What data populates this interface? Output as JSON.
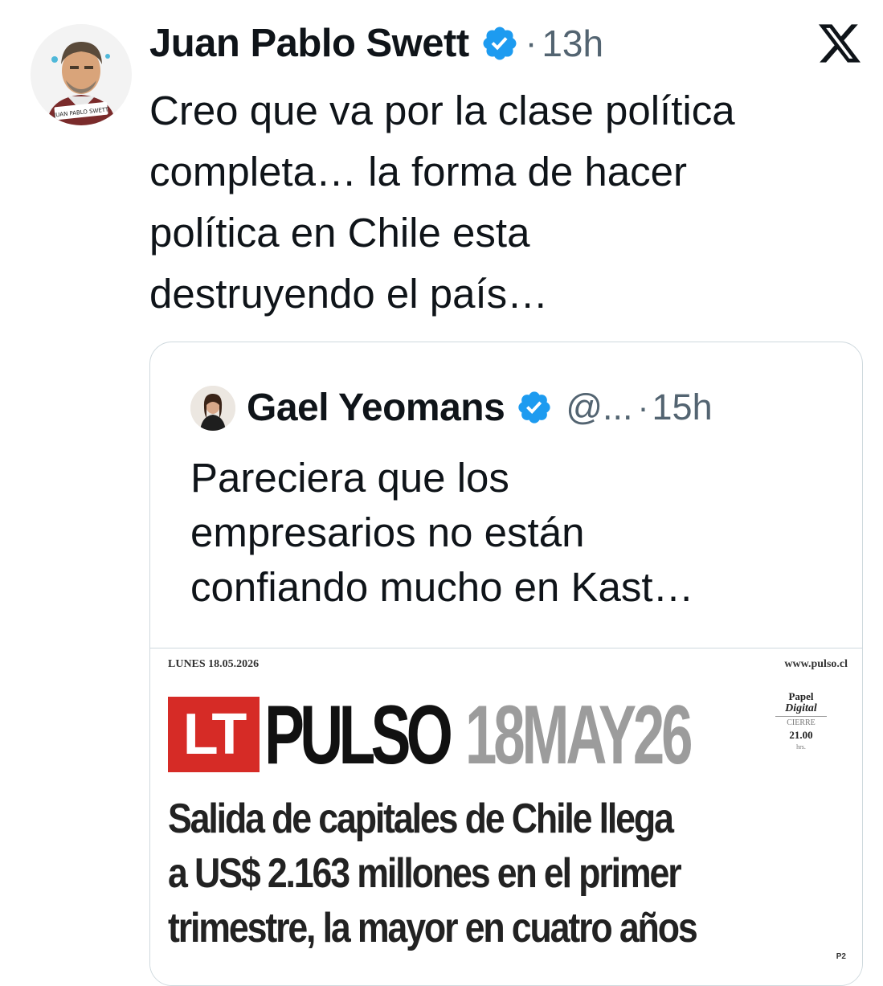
{
  "tweet": {
    "author_name": "Juan Pablo Swett",
    "separator": "·",
    "time": "13h",
    "avatar_caption": "JUAN PABLO SWETT",
    "text_lines": [
      "Creo que va por la clase política",
      "completa… la forma de hacer",
      "política en Chile esta",
      "destruyendo el país…"
    ],
    "icons": {
      "verified": "verified-badge-icon",
      "platform": "x-logo-icon"
    },
    "colors": {
      "verified": "#1d9bf0",
      "secondary_text": "#536471",
      "border": "#cfd9de"
    }
  },
  "quoted": {
    "author_name": "Gael Yeomans",
    "handle": "@...",
    "separator": "·",
    "time": "15h",
    "text_lines": [
      "Pareciera que los",
      "empresarios no están",
      "confiando mucho en Kast…"
    ]
  },
  "newspaper": {
    "date": "LUNES 18.05.2026",
    "url": "www.pulso.cl",
    "logo_mark": "LT",
    "masthead": "PULSO",
    "masthead_date": "18MAY26",
    "edition_line1": "Papel",
    "edition_line2": "Digital",
    "edition_line3": "CIERRE",
    "edition_time": "21.00",
    "edition_unit": "hrs.",
    "headline_lines": [
      "Salida de capitales de Chile llega",
      "a US$ 2.163 millones en el primer",
      "trimestre, la mayor en cuatro años"
    ],
    "page": "P2",
    "colors": {
      "logo_red": "#d62b26",
      "date_gray": "#9c9c9c"
    }
  }
}
